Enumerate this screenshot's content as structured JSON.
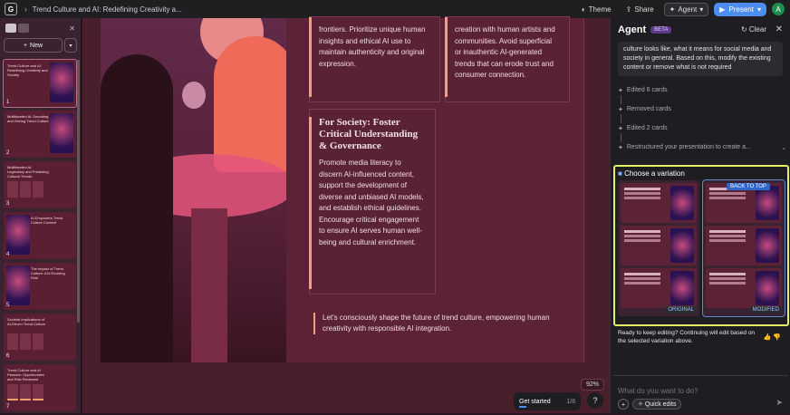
{
  "topbar": {
    "doc_title": "Trend Culture and AI: Redefining Creativity a...",
    "theme_label": "Theme",
    "share_label": "Share",
    "agent_label": "Agent",
    "present_label": "Present",
    "avatar_letter": "A"
  },
  "left_panel": {
    "new_label": "New",
    "slides": [
      {
        "num": "1",
        "title": "Trend Culture and AI: Redefining Creativity and Society"
      },
      {
        "num": "2",
        "title": "Multifaceted AI: Decoding and Driving Trend Culture"
      },
      {
        "num": "3",
        "title": "Multifaceted AI: Legendary and Predicting Cultural Trends"
      },
      {
        "num": "4",
        "title": "AI Empowers Trend Culture Content"
      },
      {
        "num": "5",
        "title": "The Impact of Trend Culture: AI's Evolving Role"
      },
      {
        "num": "6",
        "title": "Societal Implications of AI-Driven Trend Culture"
      },
      {
        "num": "7",
        "title": "Trend Culture and AI Paradox: Opportunities and Risk Reviewed"
      }
    ]
  },
  "slide": {
    "card1_text": "frontiers. Prioritize unique human insights and ethical AI use to maintain authenticity and original expression.",
    "card2_text": "creation with human artists and communities. Avoid superficial or inauthentic AI-generated trends that can erode trust and consumer connection.",
    "card3_title": "For Society: Foster Critical Understanding & Governance",
    "card3_text": "Promote media literacy to discern AI-influenced content, support the development of diverse and unbiased AI models, and establish ethical guidelines. Encourage critical engagement to ensure AI serves human well-being and cultural enrichment.",
    "quote": "Let's consciously shape the future of trend culture, empowering human creativity with responsible AI integration."
  },
  "canvas": {
    "zoom": "92%",
    "get_started": "Get started",
    "get_started_count": "1/8",
    "get_started_progress": 0.125,
    "help": "?"
  },
  "agent": {
    "title": "Agent",
    "beta": "BETA",
    "clear_label": "Clear",
    "message": "culture looks like, what it means for social media and society in general. Based on this, modify the existing content or remove what is not required",
    "steps": [
      "Edited 6 cards",
      "Removed cards",
      "Edited 2 cards",
      "Restructured your presentation to create a..."
    ],
    "variation_title": "Choose a variation",
    "original_label": "ORIGINAL",
    "modified_label": "MODIFIED",
    "back_to_top": "BACK TO TOP",
    "ready_text": "Ready to keep editing? Continuing will edit based on the selected variation above.",
    "input_placeholder": "What do you want to do?",
    "quick_edits": "Quick edits"
  }
}
